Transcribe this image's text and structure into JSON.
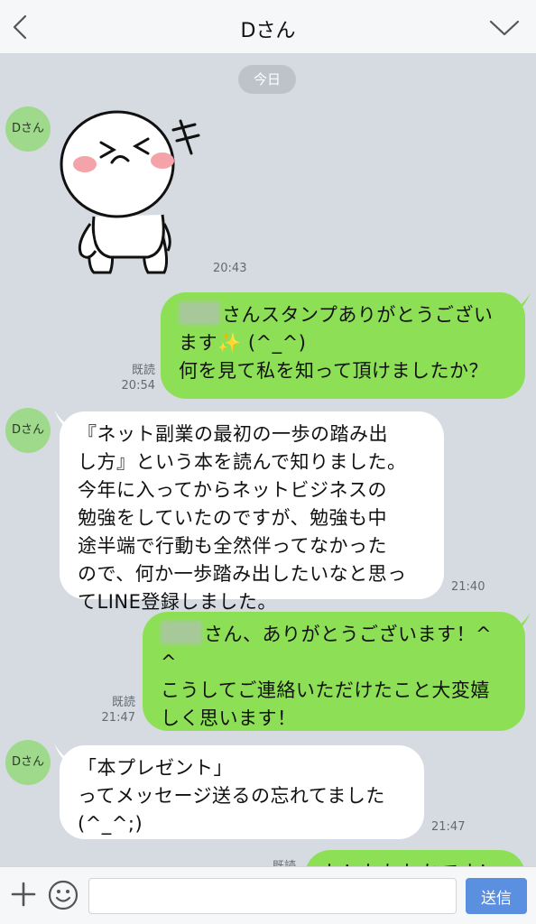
{
  "header": {
    "title": "Dさん",
    "back_icon": "chevron-left-icon",
    "menu_icon": "chevron-down-icon"
  },
  "date_separator": "今日",
  "contact": {
    "avatar_label": "Dさん"
  },
  "messages": [
    {
      "type": "sticker",
      "sender": "contact",
      "sticker": "laughing-face-sticker",
      "time": "20:43"
    },
    {
      "type": "text",
      "sender": "me",
      "has_blurred_name": true,
      "lines": [
        "さんスタンプありがとうござい",
        "ます✨ (^_^)",
        "何を見て私を知って頂けましたか？"
      ],
      "read": "既読",
      "time": "20:54"
    },
    {
      "type": "text",
      "sender": "contact",
      "lines": [
        "『ネット副業の最初の一歩の踏み出",
        "し方』という本を読んで知りました。",
        "今年に入ってからネットビジネスの",
        "勉強をしていたのですが、勉強も中",
        "途半端で行動も全然伴ってなかった",
        "ので、何か一歩踏み出したいなと思っ",
        "てLINE登録しました。"
      ],
      "time": "21:40"
    },
    {
      "type": "text",
      "sender": "me",
      "has_blurred_name": true,
      "lines": [
        "さん、ありがとうございます！^",
        "^",
        "こうしてご連絡いただけたこと大変嬉",
        "しく思います！"
      ],
      "read": "既読",
      "time": "21:47"
    },
    {
      "type": "text",
      "sender": "contact",
      "lines": [
        "「本プレゼント」",
        "ってメッセージ送るの忘れてました",
        "(^_^;)"
      ],
      "time": "21:47"
    },
    {
      "type": "text",
      "sender": "me",
      "partial": true,
      "lines": [
        "わ！わわわかです！"
      ],
      "read": "既読"
    }
  ],
  "input_bar": {
    "plus_icon": "plus-icon",
    "emoji_icon": "smiley-icon",
    "placeholder": "",
    "send_label": "送信"
  },
  "colors": {
    "chat_bg": "#d6dbe2",
    "outgoing_bubble": "#8de055",
    "incoming_bubble": "#ffffff",
    "avatar_bg": "#9fd98c",
    "send_button": "#5b8fe0"
  }
}
